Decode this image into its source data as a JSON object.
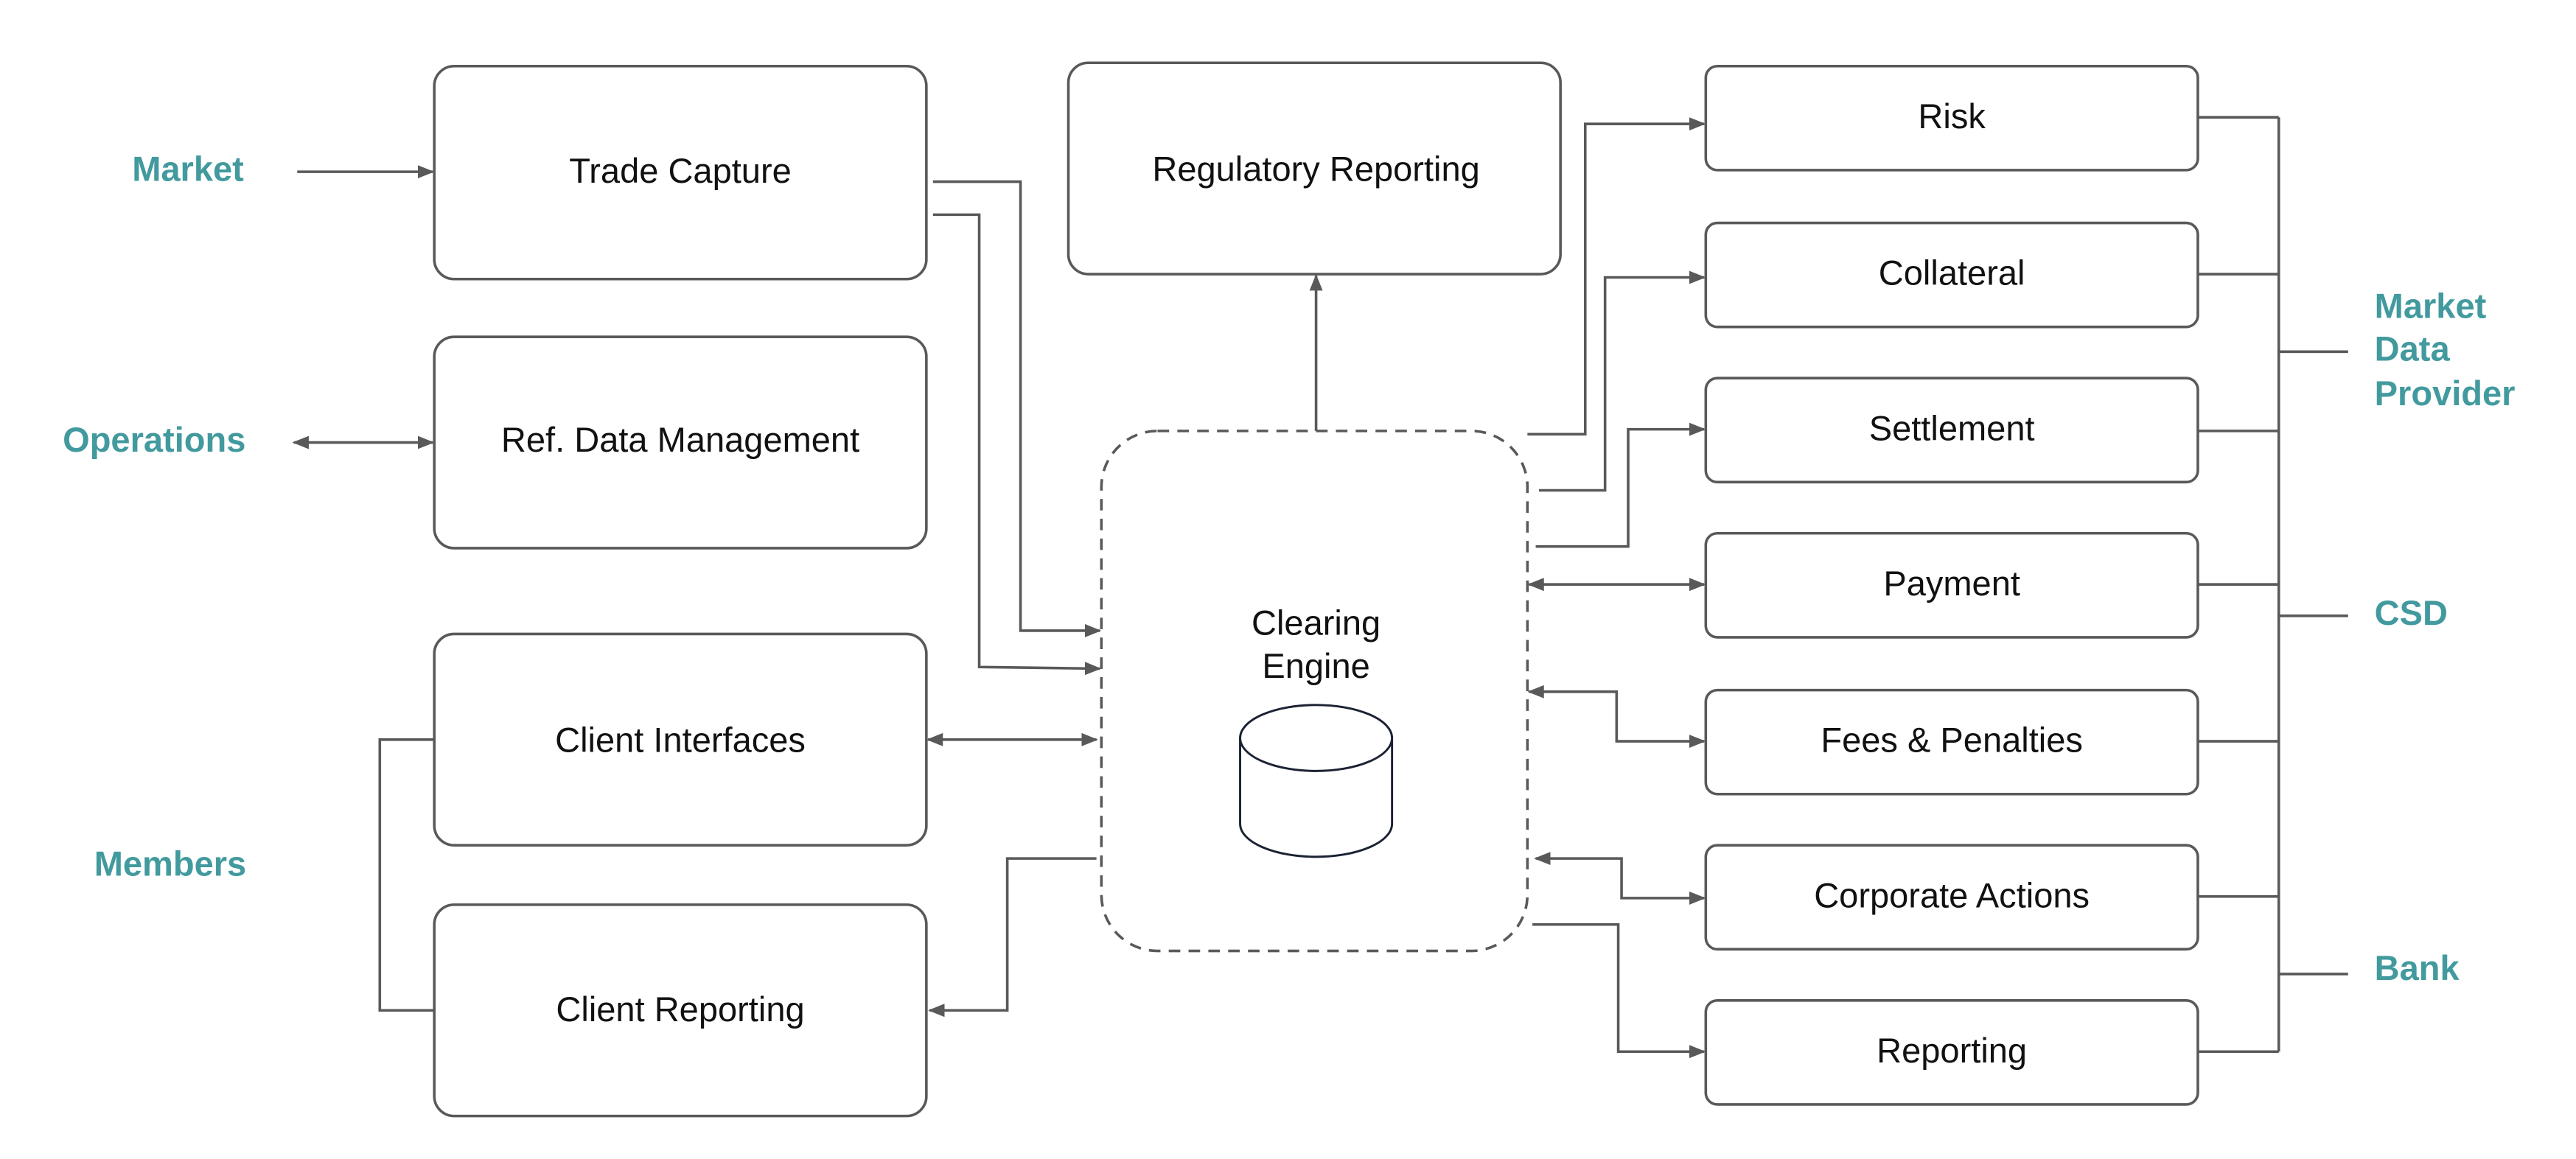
{
  "colors": {
    "accent": "#429a9e",
    "line": "#595959"
  },
  "external": {
    "market": "Market",
    "operations": "Operations",
    "members": "Members",
    "market_data_provider": [
      "Market",
      "Data",
      "Provider"
    ],
    "csd": "CSD",
    "bank": "Bank"
  },
  "left_boxes": {
    "trade_capture": "Trade Capture",
    "ref_data": "Ref. Data Management",
    "client_interfaces": "Client Interfaces",
    "client_reporting": "Client Reporting"
  },
  "center": {
    "regulatory_reporting": "Regulatory Reporting",
    "clearing_engine": [
      "Clearing",
      "Engine"
    ],
    "database_icon": "database-cylinder"
  },
  "right_boxes": [
    "Risk",
    "Collateral",
    "Settlement",
    "Payment",
    "Fees & Penalties",
    "Corporate Actions",
    "Reporting"
  ]
}
